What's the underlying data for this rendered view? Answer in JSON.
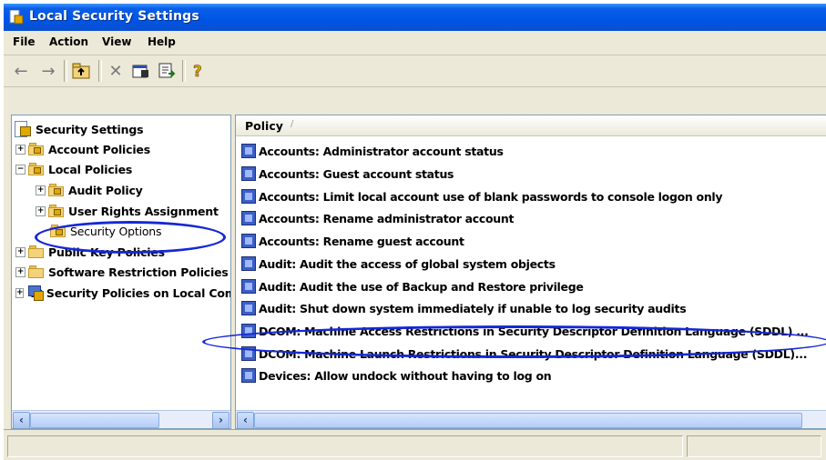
{
  "window": {
    "title": "Local Security Settings"
  },
  "menu": [
    {
      "label": "File"
    },
    {
      "label": "Action"
    },
    {
      "label": "View"
    },
    {
      "label": "Help"
    }
  ],
  "toolbar": {
    "icons": [
      "back-icon",
      "forward-icon",
      "up-folder-icon",
      "delete-icon",
      "properties-icon",
      "export-list-icon",
      "help-icon"
    ]
  },
  "tree": {
    "root": "Security Settings",
    "items": [
      {
        "label": "Account Policies"
      },
      {
        "label": "Local Policies"
      },
      {
        "label": "Audit Policy"
      },
      {
        "label": "User Rights Assignment"
      },
      {
        "label": "Security Options"
      },
      {
        "label": "Public Key Policies"
      },
      {
        "label": "Software Restriction Policies"
      },
      {
        "label": "IP Security Policies on Local Computer"
      }
    ]
  },
  "list": {
    "column_header": "Policy",
    "sort_indicator": "/",
    "rows": [
      "Accounts: Administrator account status",
      "Accounts: Guest account status",
      "Accounts: Limit local account use of blank passwords to console logon only",
      "Accounts: Rename administrator account",
      "Accounts: Rename guest account",
      "Audit: Audit the access of global system objects",
      "Audit: Audit the use of Backup and Restore privilege",
      "Audit: Shut down system immediately if unable to log security audits",
      "DCOM: Machine Access Restrictions in Security Descriptor Definition Language (SDDL) ...",
      "DCOM: Machine Launch Restrictions in Security Descriptor Definition Language (SDDL)...",
      "Devices: Allow undock without having to log on"
    ]
  },
  "highlight_color": "#1528d6"
}
